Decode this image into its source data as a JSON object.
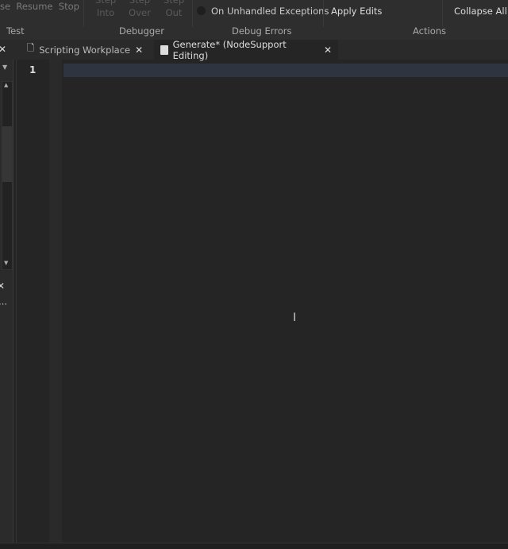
{
  "ribbon": {
    "test_buttons": "se  Resume  Stop",
    "debugger_buttons": [
      {
        "line1": "Step",
        "line2": "Into"
      },
      {
        "line1": "Step",
        "line2": "Over"
      },
      {
        "line1": "Step",
        "line2": "Out"
      }
    ],
    "exceptions_label": "On Unhandled Exceptions",
    "apply_edits": "Apply Edits",
    "collapse_all": "Collapse All F",
    "groups": {
      "test": "Test",
      "debugger": "Debugger",
      "debug_errors": "Debug Errors",
      "actions": "Actions"
    }
  },
  "tabs": [
    {
      "label": "Scripting Workplace",
      "icon": "place-icon"
    },
    {
      "label": "Generate* (NodeSupport Editing)",
      "icon": "script-icon"
    }
  ],
  "editor": {
    "line_numbers": [
      "1"
    ],
    "content": ""
  }
}
